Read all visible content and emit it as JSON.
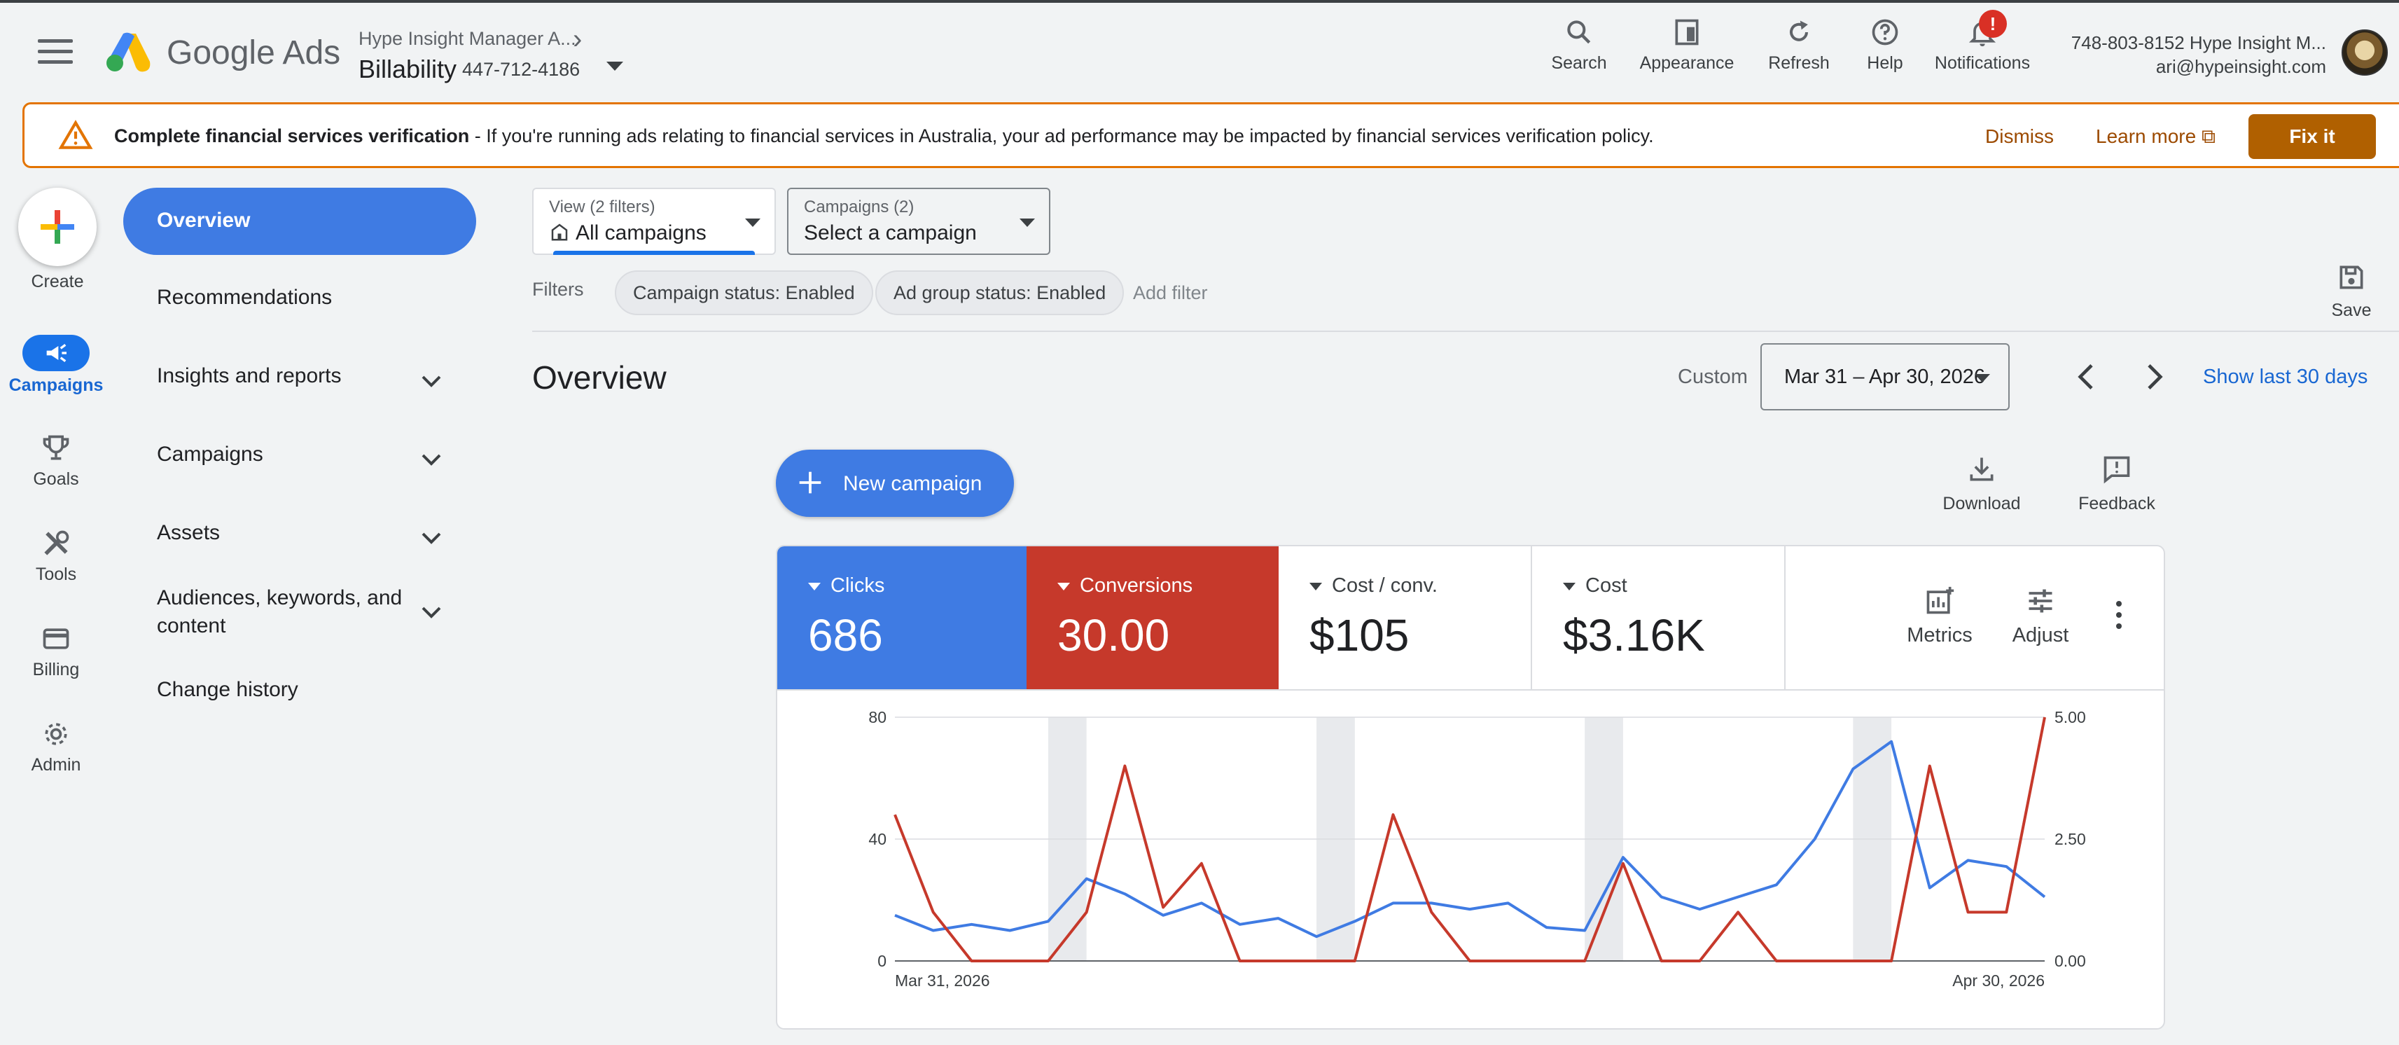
{
  "header": {
    "brand": "Google Ads",
    "manager": "Hype Insight Manager A...",
    "account_name": "Billability",
    "account_id": "447-712-4186",
    "buttons": [
      {
        "label": "Search",
        "icon": "search-icon"
      },
      {
        "label": "Appearance",
        "icon": "appearance-icon"
      },
      {
        "label": "Refresh",
        "icon": "refresh-icon"
      },
      {
        "label": "Help",
        "icon": "help-icon"
      },
      {
        "label": "Notifications",
        "icon": "bell-icon"
      }
    ],
    "notification_badge": "!",
    "user_line1": "748-803-8152 Hype Insight M...",
    "user_email": "ari@hypeinsight.com"
  },
  "banner": {
    "title": "Complete financial services verification",
    "message": " - If you're running ads relating to financial services in Australia, your ad performance may be impacted by financial services verification policy.",
    "dismiss": "Dismiss",
    "learn_more": "Learn more",
    "fix_it": "Fix it"
  },
  "rail": {
    "create": "Create",
    "items": [
      {
        "label": "Campaigns",
        "icon": "megaphone-icon",
        "active": true
      },
      {
        "label": "Goals",
        "icon": "trophy-icon"
      },
      {
        "label": "Tools",
        "icon": "tools-icon"
      },
      {
        "label": "Billing",
        "icon": "credit-card-icon"
      },
      {
        "label": "Admin",
        "icon": "gear-icon"
      }
    ]
  },
  "nav": {
    "items": [
      {
        "label": "Overview"
      },
      {
        "label": "Recommendations"
      },
      {
        "label": "Insights and reports"
      },
      {
        "label": "Campaigns"
      },
      {
        "label": "Assets"
      },
      {
        "label": "Audiences, keywords, and content"
      },
      {
        "label": "Change history"
      }
    ]
  },
  "selectors": {
    "view_label": "View (2 filters)",
    "view_value": "All campaigns",
    "campaigns_label": "Campaigns (2)",
    "campaigns_value": "Select a campaign"
  },
  "filters": {
    "label": "Filters",
    "chips": [
      "Campaign status: Enabled",
      "Ad group status: Enabled"
    ],
    "add": "Add filter",
    "save": "Save"
  },
  "overview": {
    "title": "Overview",
    "custom": "Custom",
    "date_range": "Mar 31 – Apr 30, 2026",
    "show_last": "Show last 30 days",
    "new_campaign": "New campaign",
    "download": "Download",
    "feedback": "Feedback"
  },
  "scorecards": [
    {
      "name": "Clicks",
      "value": "686"
    },
    {
      "name": "Conversions",
      "value": "30.00"
    },
    {
      "name": "Cost / conv.",
      "value": "$105"
    },
    {
      "name": "Cost",
      "value": "$3.16K"
    }
  ],
  "card_buttons": {
    "metrics": "Metrics",
    "adjust": "Adjust"
  },
  "colors": {
    "clicks": "#3f7be3",
    "conversions": "#c6392b",
    "accent": "#1a73e8",
    "warning": "#e37400"
  },
  "chart_data": {
    "type": "line",
    "x_start_label": "Mar 31, 2026",
    "x_end_label": "Apr 30, 2026",
    "left_axis_ticks": [
      "0",
      "40",
      "80"
    ],
    "right_axis_ticks": [
      "0.00",
      "2.50",
      "5.00"
    ],
    "ylim_left": [
      0,
      80
    ],
    "ylim_right": [
      0,
      5
    ],
    "weekend_bands_day_index": [
      4,
      11,
      18,
      25
    ],
    "series": [
      {
        "name": "Clicks",
        "axis": "left",
        "values": [
          15,
          10,
          12,
          10,
          13,
          27,
          22,
          15,
          19,
          12,
          14,
          8,
          13,
          19,
          19,
          17,
          19,
          11,
          10,
          34,
          21,
          17,
          21,
          25,
          40,
          63,
          72,
          24,
          33,
          31,
          21
        ]
      },
      {
        "name": "Conversions",
        "axis": "right",
        "values": [
          3,
          1,
          0,
          0,
          0,
          1,
          4,
          1.1,
          2,
          0,
          0,
          0,
          0,
          3,
          1,
          0,
          0,
          0,
          0,
          2,
          0,
          0,
          1,
          0,
          0,
          0,
          0,
          4,
          1,
          1,
          5
        ]
      }
    ]
  }
}
